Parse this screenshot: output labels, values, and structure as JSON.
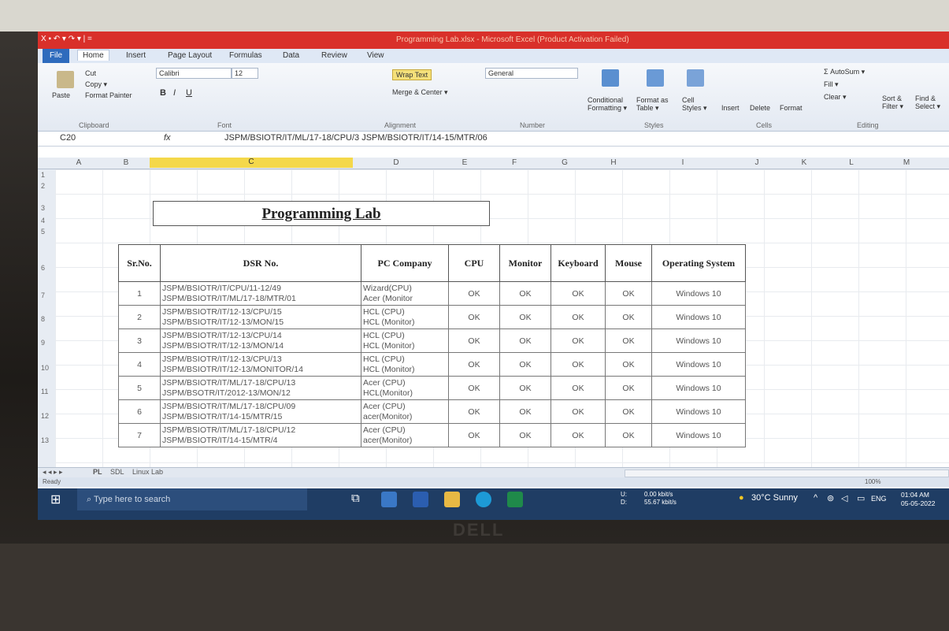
{
  "window": {
    "app_title": "Programming Lab.xlsx - Microsoft Excel (Product Activation Failed)",
    "qat": "X ▪ ↶ ▾ ↷ ▾ | ="
  },
  "ribbon_tabs": [
    "File",
    "Home",
    "Insert",
    "Page Layout",
    "Formulas",
    "Data",
    "Review",
    "View"
  ],
  "ribbon": {
    "clipboard": {
      "cut": "Cut",
      "copy": "Copy ▾",
      "paste": "Paste",
      "format_painter": "Format Painter",
      "label": "Clipboard"
    },
    "font": {
      "name": "Calibri",
      "size": "12",
      "bold": "B",
      "italic": "I",
      "underline": "U",
      "label": "Font"
    },
    "alignment": {
      "wrap": "Wrap Text",
      "merge": "Merge & Center ▾",
      "label": "Alignment"
    },
    "number": {
      "format": "General",
      "label": "Number"
    },
    "styles": {
      "cond": "Conditional Formatting ▾",
      "table": "Format as Table ▾",
      "cell": "Cell Styles ▾",
      "label": "Styles"
    },
    "cells": {
      "insert": "Insert",
      "delete": "Delete",
      "format": "Format",
      "label": "Cells"
    },
    "editing": {
      "autosum": "Σ AutoSum ▾",
      "fill": "Fill ▾",
      "clear": "Clear ▾",
      "sort": "Sort & Filter ▾",
      "find": "Find & Select ▾",
      "label": "Editing"
    }
  },
  "formula_bar": {
    "name_box": "C20",
    "fx": "fx",
    "value": "JSPM/BSIOTR/IT/ML/17-18/CPU/3   JSPM/BSIOTR/IT/14-15/MTR/06"
  },
  "columns": [
    "A",
    "B",
    "C",
    "D",
    "E",
    "F",
    "G",
    "H",
    "I",
    "J",
    "K",
    "L",
    "M"
  ],
  "rows": [
    "1",
    "2",
    "3",
    "4",
    "5",
    "6",
    "7",
    "8",
    "9",
    "10",
    "11",
    "12",
    "13"
  ],
  "sheet_title": "Programming Lab",
  "table": {
    "headers": [
      "Sr.No.",
      "DSR No.",
      "PC Company",
      "CPU",
      "Monitor",
      "Keyboard",
      "Mouse",
      "Operating System"
    ],
    "rows": [
      {
        "sr": "1",
        "dsr1": "JSPM/BSIOTR/IT/CPU/11-12/49",
        "dsr2": "JSPM/BSIOTR/IT/ML/17-18/MTR/01",
        "pc1": "Wizard(CPU)",
        "pc2": "Acer (Monitor",
        "cpu": "OK",
        "monitor": "OK",
        "keyboard": "OK",
        "mouse": "OK",
        "os": "Windows 10"
      },
      {
        "sr": "2",
        "dsr1": "JSPM/BSIOTR/IT/12-13/CPU/15",
        "dsr2": "JSPM/BSIOTR/IT/12-13/MON/15",
        "pc1": "HCL (CPU)",
        "pc2": "HCL (Monitor)",
        "cpu": "OK",
        "monitor": "OK",
        "keyboard": "OK",
        "mouse": "OK",
        "os": "Windows 10"
      },
      {
        "sr": "3",
        "dsr1": "JSPM/BSIOTR/IT/12-13/CPU/14",
        "dsr2": "JSPM/BSIOTR/IT/12-13/MON/14",
        "pc1": "HCL (CPU)",
        "pc2": "HCL (Monitor)",
        "cpu": "OK",
        "monitor": "OK",
        "keyboard": "OK",
        "mouse": "OK",
        "os": "Windows 10"
      },
      {
        "sr": "4",
        "dsr1": "JSPM/BSIOTR/IT/12-13/CPU/13",
        "dsr2": "JSPM/BSIOTR/IT/12-13/MONITOR/14",
        "pc1": "HCL (CPU)",
        "pc2": "HCL (Monitor)",
        "cpu": "OK",
        "monitor": "OK",
        "keyboard": "OK",
        "mouse": "OK",
        "os": "Windows 10"
      },
      {
        "sr": "5",
        "dsr1": "JSPM/BSIOTR/IT/ML/17-18/CPU/13",
        "dsr2": "JSPM/BSOTR/IT/2012-13/MON/12",
        "pc1": "Acer (CPU)",
        "pc2": "HCL(Monitor)",
        "cpu": "OK",
        "monitor": "OK",
        "keyboard": "OK",
        "mouse": "OK",
        "os": "Windows 10"
      },
      {
        "sr": "6",
        "dsr1": "JSPM/BSIOTR/IT/ML/17-18/CPU/09",
        "dsr2": "JSPM/BSIOTR/IT/14-15/MTR/15",
        "pc1": "Acer (CPU)",
        "pc2": "acer(Monitor)",
        "cpu": "OK",
        "monitor": "OK",
        "keyboard": "OK",
        "mouse": "OK",
        "os": "Windows 10"
      },
      {
        "sr": "7",
        "dsr1": "JSPM/BSIOTR/IT/ML/17-18/CPU/12",
        "dsr2": "JSPM/BSIOTR/IT/14-15/MTR/4",
        "pc1": "Acer (CPU)",
        "pc2": "acer(Monitor)",
        "cpu": "OK",
        "monitor": "OK",
        "keyboard": "OK",
        "mouse": "OK",
        "os": "Windows 10"
      }
    ]
  },
  "sheet_tabs": [
    "PL",
    "SDL",
    "Linux Lab"
  ],
  "status": {
    "ready": "Ready",
    "zoom": "100%"
  },
  "taskbar": {
    "search_placeholder": "Type here to search",
    "net_up_label": "U:",
    "net_up": "0.00 kbit/s",
    "net_down_label": "D:",
    "net_down": "55.67 kbit/s",
    "weather": "30°C  Sunny",
    "lang": "ENG",
    "time": "01:04 AM",
    "date": "05-05-2022"
  },
  "brand": "DELL",
  "colors": {
    "title_red": "#d9302a",
    "selected_col": "#f4d84a",
    "taskbar": "#1f3d64",
    "file_tab": "#2e6bbd"
  }
}
